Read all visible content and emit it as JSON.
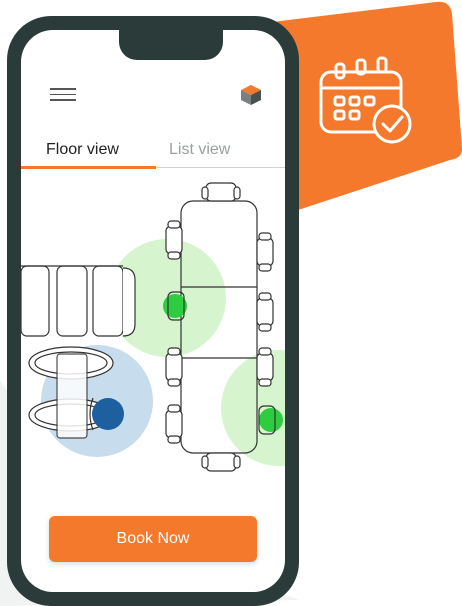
{
  "app": {
    "tabs": [
      {
        "label": "Floor view",
        "active": true
      },
      {
        "label": "List view",
        "active": false
      }
    ],
    "book_button": "Book Now"
  },
  "icons": {
    "menu": "hamburger-menu-icon",
    "logo": "cube-logo-icon",
    "calendar": "calendar-check-icon"
  },
  "colors": {
    "accent": "#f4792c",
    "phone_frame": "#2a3b3a",
    "available": "#2ecc40",
    "selected": "#1e5fa0",
    "available_zone": "#d6f5cf",
    "selected_zone": "#c7dcec"
  }
}
